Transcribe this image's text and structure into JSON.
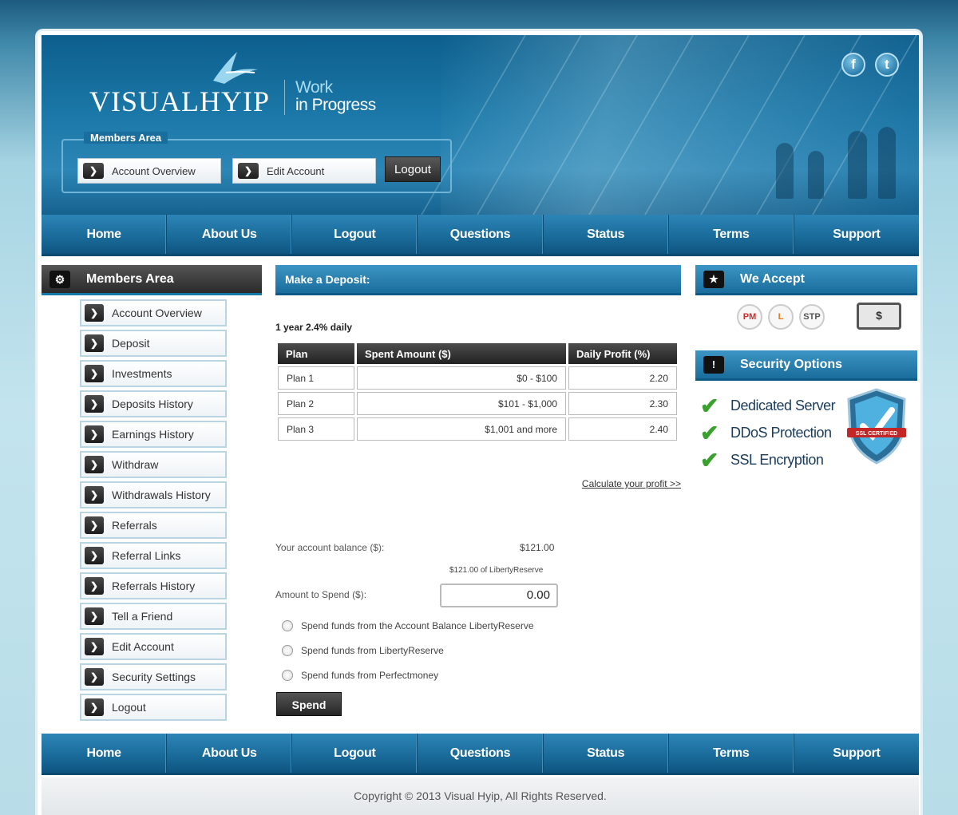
{
  "brand": {
    "logo_text": "VISUALHYIP",
    "tagline_line1": "Work",
    "tagline_line2": "in Progress"
  },
  "social": [
    {
      "icon": "facebook-icon",
      "glyph": "f"
    },
    {
      "icon": "twitter-icon",
      "glyph": "t"
    }
  ],
  "header_members": {
    "legend": "Members Area",
    "account_overview": "Account Overview",
    "edit_account": "Edit Account",
    "logout": "Logout"
  },
  "nav": [
    "Home",
    "About Us",
    "Logout",
    "Questions",
    "Status",
    "Terms",
    "Support"
  ],
  "sidebar": {
    "title": "Members Area",
    "items": [
      "Account Overview",
      "Deposit",
      "Investments",
      "Deposits History",
      "Earnings History",
      "Withdraw",
      "Withdrawals History",
      "Referrals",
      "Referral Links",
      "Referrals History",
      "Tell a Friend",
      "Edit Account",
      "Security Settings",
      "Logout"
    ]
  },
  "deposit": {
    "title": "Make a Deposit:",
    "plan_name": "1 year 2.4% daily",
    "table_headers": [
      "Plan",
      "Spent Amount ($)",
      "Daily Profit (%)"
    ],
    "rows": [
      [
        "Plan 1",
        "$0 - $100",
        "2.20"
      ],
      [
        "Plan 2",
        "$101 - $1,000",
        "2.30"
      ],
      [
        "Plan 3",
        "$1,001 and more",
        "2.40"
      ]
    ],
    "calc_link": "Calculate your profit >>",
    "balance_label": "Your account balance ($):",
    "balance_value": "$121.00",
    "balance_sub": "$121.00 of LibertyReserve",
    "amount_label": "Amount to Spend ($):",
    "amount_value": "0.00",
    "options": [
      "Spend funds from the Account Balance LibertyReserve",
      "Spend funds from LibertyReserve",
      "Spend funds from Perfectmoney"
    ],
    "spend_button": "Spend"
  },
  "we_accept": {
    "title": "We Accept",
    "icons": [
      {
        "name": "perfectmoney-icon",
        "glyph": "PM",
        "color": "#d22d2d"
      },
      {
        "name": "libertyreserve-icon",
        "glyph": "L",
        "color": "#e07b1a"
      },
      {
        "name": "solidtrustpay-icon",
        "glyph": "STP",
        "color": "#555555"
      }
    ],
    "cash_glyph": "$"
  },
  "security": {
    "title": "Security Options",
    "items": [
      "Dedicated Server",
      "DDoS Protection",
      "SSL Encryption"
    ],
    "badge_text": "SSL CERTIFIED"
  },
  "footer": {
    "copyright": "Copyright © 2013 Visual Hyip, All Rights Reserved."
  },
  "colors": {
    "brand_blue": "#1a6d9c",
    "dark_button": "#2a2a2a",
    "check_green": "#3aa12e"
  }
}
